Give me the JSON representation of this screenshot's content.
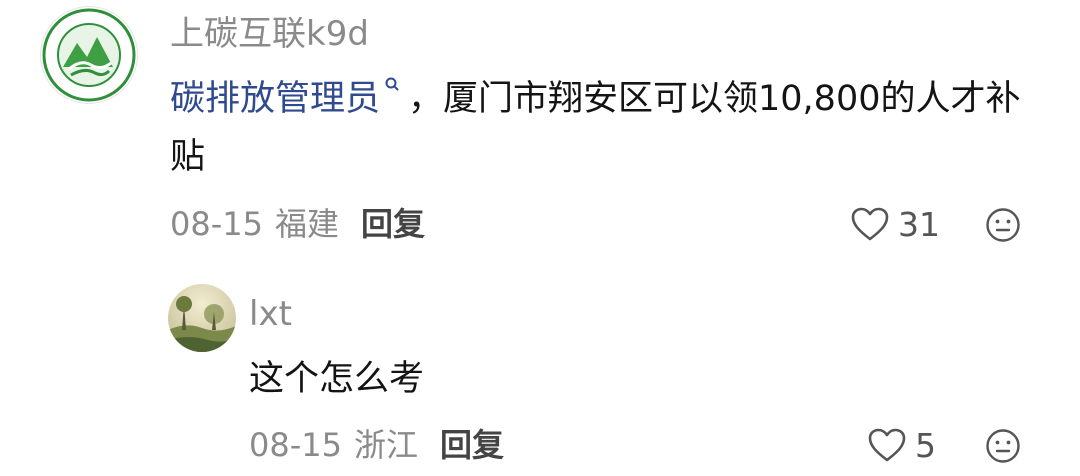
{
  "comments": [
    {
      "username": "上碳互联k9d",
      "avatar_icon": "green-mountain-logo",
      "text_keyword": "碳排放管理员",
      "text_rest": "，厦门市翔安区可以领10,800的人才补贴",
      "date": "08-15",
      "region": "福建",
      "reply_label": "回复",
      "like_count": "31"
    }
  ],
  "replies": [
    {
      "username": "lxt",
      "avatar_icon": "landscape-painting-avatar",
      "text": "这个怎么考",
      "date": "08-15",
      "region": "浙江",
      "reply_label": "回复",
      "like_count": "5"
    }
  ],
  "icons": {
    "like": "heart-outline-icon",
    "emoji": "neutral-face-icon",
    "search": "search-icon"
  },
  "colors": {
    "keyword_link": "#2f4a8f",
    "meta_gray": "#8a8a8a",
    "logo_green": "#2f8f3a"
  }
}
